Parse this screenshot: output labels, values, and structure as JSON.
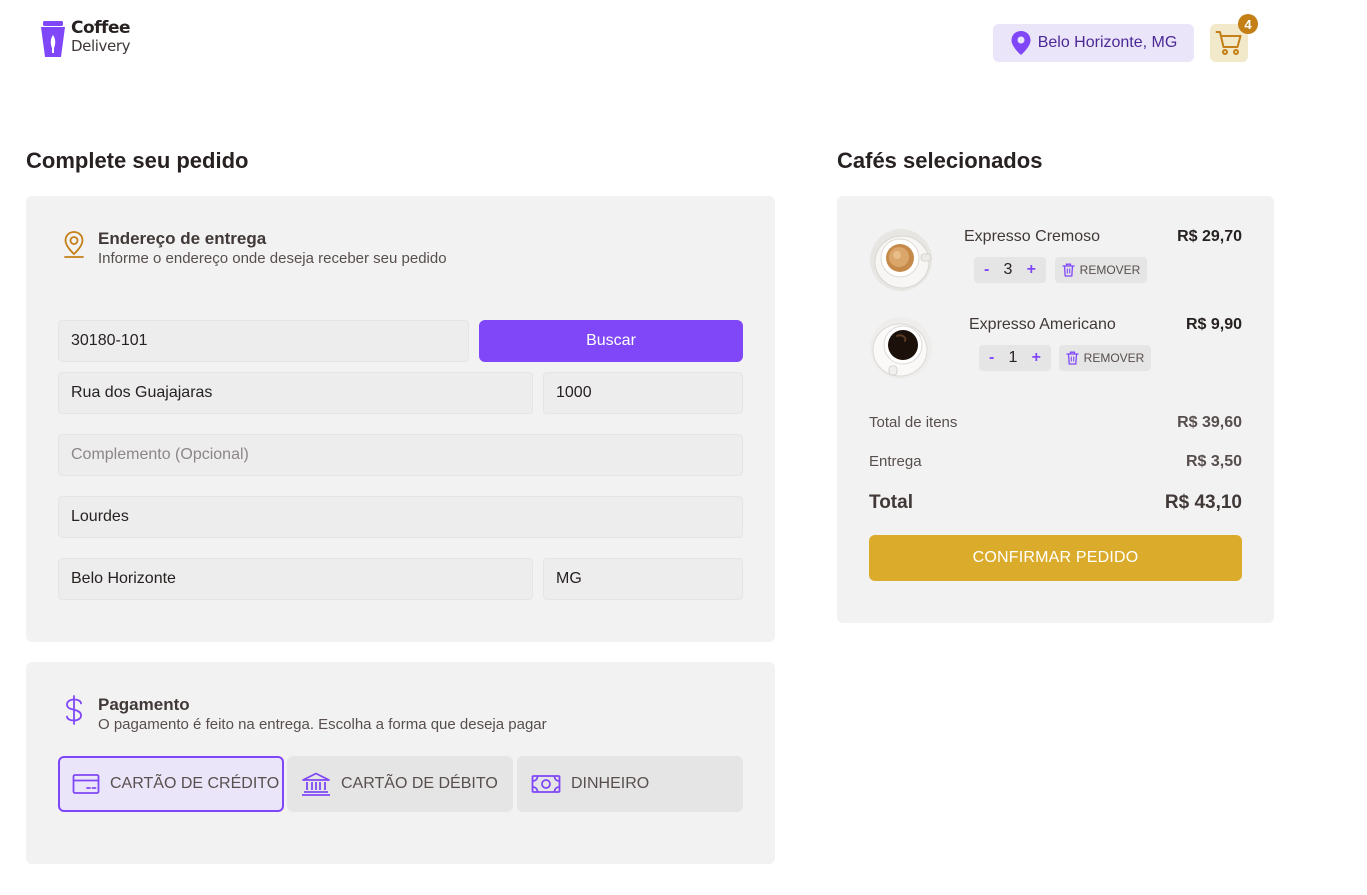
{
  "header": {
    "logo_line1": "Coffee",
    "logo_line2": "Delivery",
    "location": "Belo Horizonte, MG",
    "cart_count": "4"
  },
  "checkout": {
    "title": "Complete seu pedido",
    "address": {
      "heading": "Endereço de entrega",
      "subheading": "Informe o endereço onde deseja receber seu pedido",
      "cep": "30180-101",
      "search_label": "Buscar",
      "street": "Rua dos Guajajaras",
      "number": "1000",
      "complement_placeholder": "Complemento (Opcional)",
      "neighborhood": "Lourdes",
      "city": "Belo Horizonte",
      "state": "MG"
    },
    "payment": {
      "heading": "Pagamento",
      "subheading": "O pagamento é feito na entrega. Escolha a forma que deseja pagar",
      "options": [
        {
          "label": "CARTÃO DE CRÉDITO",
          "icon": "credit-card-icon",
          "selected": true
        },
        {
          "label": "CARTÃO DE DÉBITO",
          "icon": "bank-icon",
          "selected": false
        },
        {
          "label": "DINHEIRO",
          "icon": "money-icon",
          "selected": false
        }
      ]
    }
  },
  "cart": {
    "title": "Cafés selecionados",
    "items": [
      {
        "name": "Expresso Cremoso",
        "price": "R$ 29,70",
        "qty": "3",
        "remove_label": "REMOVER"
      },
      {
        "name": "Expresso Americano",
        "price": "R$ 9,90",
        "qty": "1",
        "remove_label": "REMOVER"
      }
    ],
    "qty_minus": "-",
    "qty_plus": "+",
    "summary": {
      "items_label": "Total de itens",
      "items_value": "R$ 39,60",
      "delivery_label": "Entrega",
      "delivery_value": "R$ 3,50",
      "total_label": "Total",
      "total_value": "R$ 43,10"
    },
    "confirm_label": "CONFIRMAR PEDIDO"
  },
  "colors": {
    "purple": "#8047f8",
    "purple_dark": "#4b2995",
    "yellow": "#dbac2c",
    "yellow_dark": "#c47f17"
  }
}
